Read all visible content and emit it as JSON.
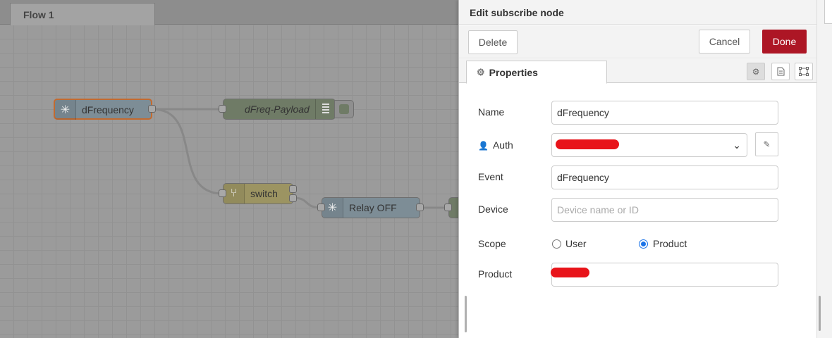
{
  "workspace": {
    "tab_label": "Flow 1",
    "nodes": {
      "dfrequency": "dFrequency",
      "payload": "dFreq-Payload",
      "switch": "switch",
      "relay": "Relay OFF"
    }
  },
  "editor": {
    "title": "Edit subscribe node",
    "delete_label": "Delete",
    "cancel_label": "Cancel",
    "done_label": "Done",
    "tab_properties": "Properties",
    "fields": {
      "name_label": "Name",
      "name_value": "dFrequency",
      "auth_label": "Auth",
      "auth_value": "",
      "event_label": "Event",
      "event_value": "dFrequency",
      "device_label": "Device",
      "device_placeholder": "Device name or ID",
      "scope_label": "Scope",
      "scope_options": [
        "User",
        "Product"
      ],
      "scope_selected": "Product",
      "product_label": "Product",
      "product_value": ""
    }
  },
  "colors": {
    "done_button": "#ad1625",
    "selected_node_border": "#c26a30",
    "radio_accent": "#1a73e8",
    "redaction": "#e8141a"
  }
}
